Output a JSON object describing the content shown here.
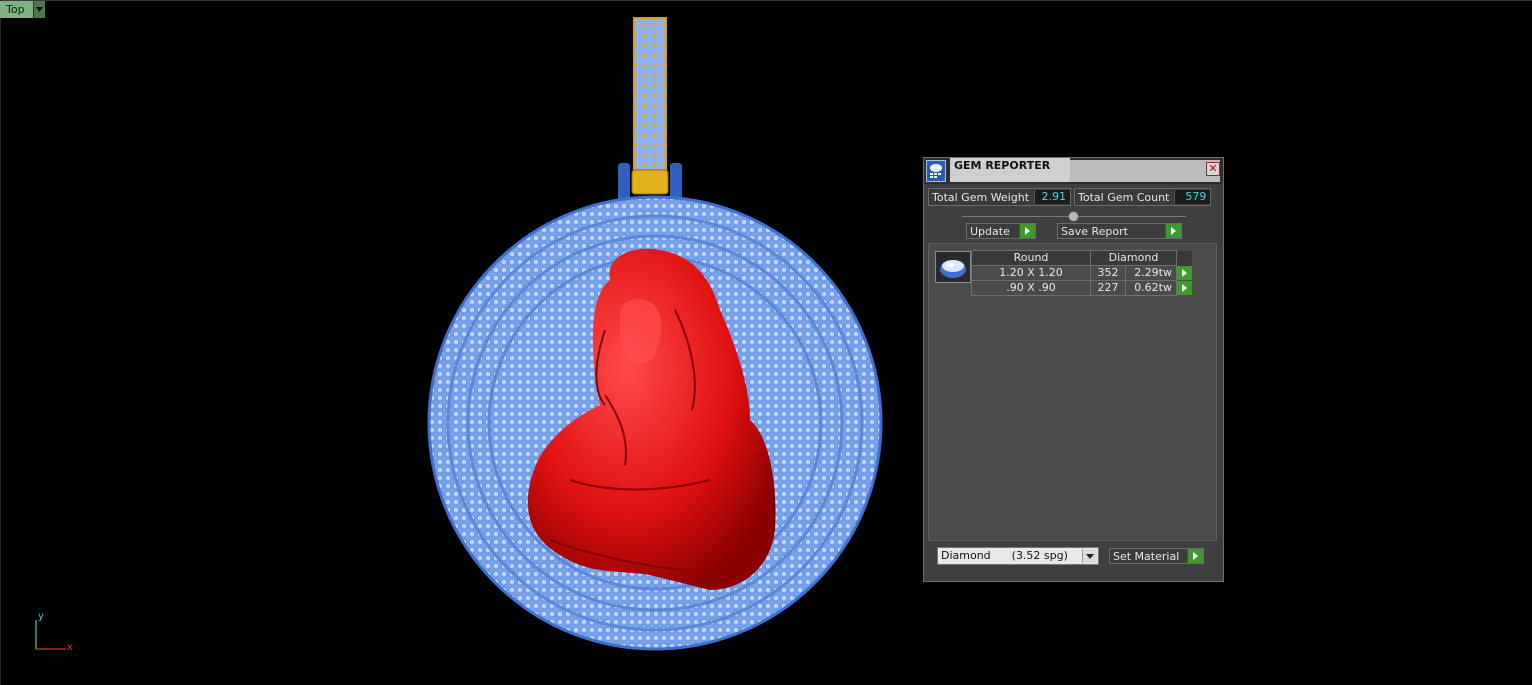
{
  "viewport": {
    "view_name": "Top",
    "axis": {
      "y": "y",
      "x": "x"
    }
  },
  "gem_reporter": {
    "title": "GEM REPORTER",
    "close_glyph": "✕",
    "total_gem_weight_label": "Total Gem Weight",
    "total_gem_weight": "2.91",
    "total_gem_count_label": "Total Gem Count",
    "total_gem_count": "579",
    "update_label": "Update",
    "save_report_label": "Save Report",
    "table": {
      "headers": [
        "Round",
        "Diamond"
      ],
      "rows": [
        {
          "size": "1.20 X 1.20",
          "count": "352",
          "weight": "2.29tw"
        },
        {
          "size": ".90 X .90",
          "count": "227",
          "weight": "0.62tw"
        }
      ]
    },
    "material_value": "Diamond      (3.52 spg)",
    "set_material_label": "Set Material"
  },
  "colors": {
    "figure": "#e01010",
    "gem": "#8fb7ff",
    "metal_gold": "#d9a014",
    "accent_value": "#46d6e0",
    "go_button": "#3e9a2a"
  }
}
